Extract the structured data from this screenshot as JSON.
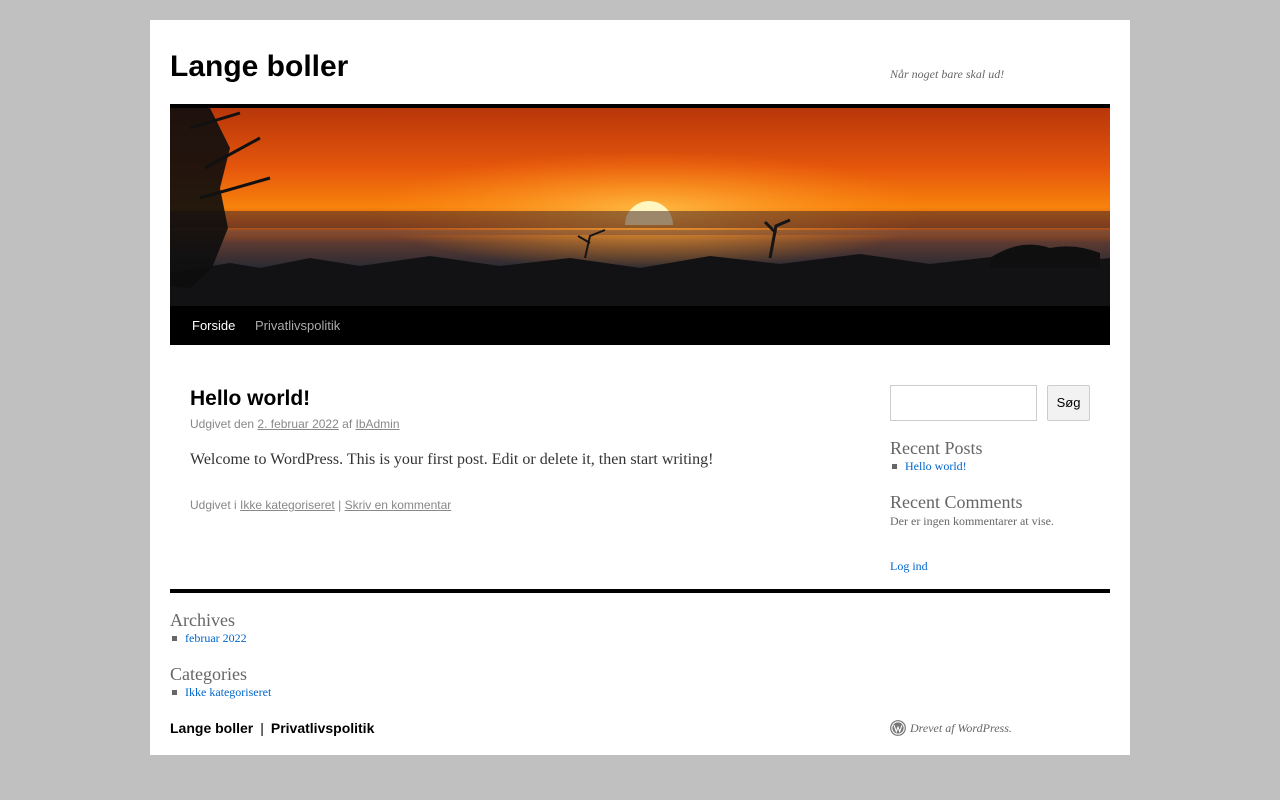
{
  "site": {
    "title": "Lange boller",
    "tagline": "Når noget bare skal ud!"
  },
  "nav": {
    "items": [
      {
        "label": "Forside",
        "current": true
      },
      {
        "label": "Privatlivspolitik",
        "current": false
      }
    ]
  },
  "post": {
    "title": "Hello world!",
    "published_prefix": "Udgivet den",
    "date": "2. februar 2022",
    "author_prefix": "af",
    "author": "IbAdmin",
    "body": "Welcome to WordPress. This is your first post. Edit or delete it, then start writing!",
    "category_prefix": "Udgivet i",
    "category": "Ikke kategoriseret",
    "separator": "|",
    "comment_link": "Skriv en kommentar"
  },
  "sidebar": {
    "search_button": "Søg",
    "search_value": "",
    "recent_posts_title": "Recent Posts",
    "recent_posts": [
      "Hello world!"
    ],
    "recent_comments_title": "Recent Comments",
    "no_comments": "Der er ingen kommentarer at vise.",
    "login": "Log ind"
  },
  "footer_widgets": {
    "archives_title": "Archives",
    "archives": [
      "februar 2022"
    ],
    "categories_title": "Categories",
    "categories": [
      "Ikke kategoriseret"
    ]
  },
  "footer": {
    "site_link": "Lange boller",
    "separator": "|",
    "privacy_link": "Privatlivspolitik",
    "powered_by": "Drevet af WordPress."
  },
  "colors": {
    "page_background": "#c0c0c0",
    "link": "#0066cc",
    "nav_background": "#000000"
  },
  "icons": {
    "footer": "wordpress-icon"
  }
}
